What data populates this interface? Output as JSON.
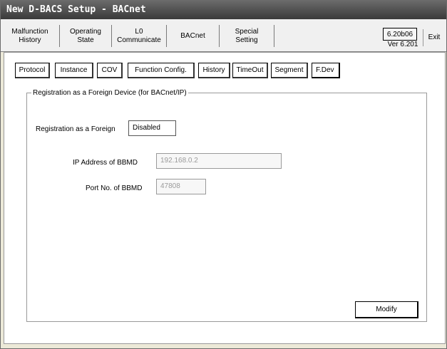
{
  "window": {
    "title": "New D-BACS Setup - BACnet"
  },
  "top_tabs": [
    {
      "label": "Malfunction\nHistory"
    },
    {
      "label": "Operating\nState"
    },
    {
      "label": "L0\nCommunicate"
    },
    {
      "label": "BACnet"
    },
    {
      "label": "Special\nSetting"
    }
  ],
  "version": {
    "build": "6.20b06",
    "ver": "Ver 6.201"
  },
  "exit_label": "Exit",
  "sub_tabs": [
    {
      "label": "Protocol"
    },
    {
      "label": "Instance"
    },
    {
      "label": "COV"
    },
    {
      "label": "Function Config."
    },
    {
      "label": "History"
    },
    {
      "label": "TimeOut"
    },
    {
      "label": "Segment"
    },
    {
      "label": "F.Dev"
    }
  ],
  "foreign_device": {
    "group_title": "Registration as a Foreign Device (for BACnet/IP)",
    "registration_label": "Registration as a Foreign",
    "registration_value": "Disabled",
    "ip_label": "IP Address of BBMD",
    "ip_value": "192.168.0.2",
    "port_label": "Port No. of BBMD",
    "port_value": "47808"
  },
  "modify_label": "Modify"
}
